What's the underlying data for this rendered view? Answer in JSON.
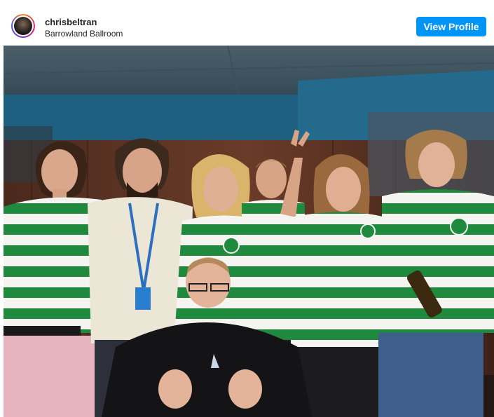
{
  "post": {
    "username": "chrisbeltran",
    "location": "Barrowland Ballroom",
    "view_profile_label": "View Profile",
    "avatar_icon": "user-avatar-icon",
    "accent_color": "#0095f6"
  },
  "photo": {
    "subject": "group photo",
    "palette": {
      "ceiling": "#3a5563",
      "wall_blue": "#1f5f7f",
      "wood": "#5a3324",
      "hoop_green": "#1f8a3d",
      "hoop_white": "#f4f4f0"
    }
  }
}
